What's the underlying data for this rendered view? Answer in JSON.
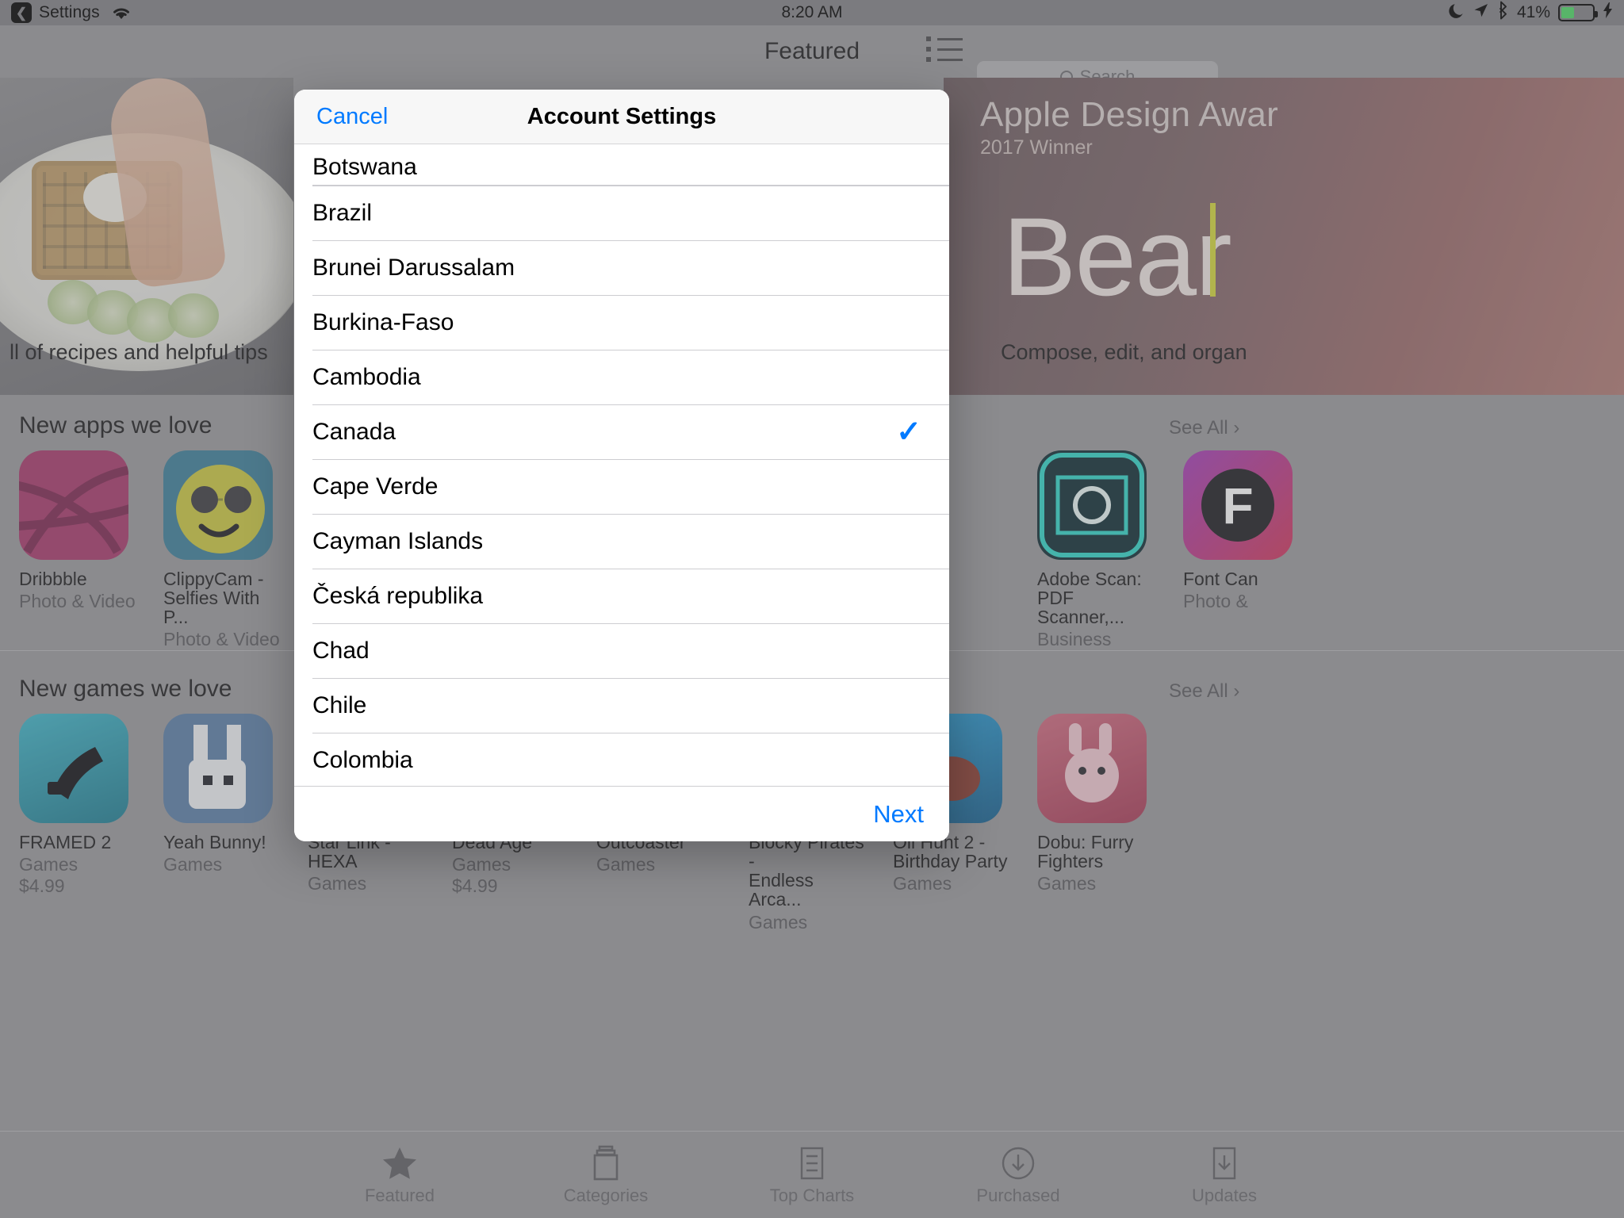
{
  "status_bar": {
    "back_label": "Settings",
    "back_icon": "chevron-left-icon",
    "wifi_icon": "wifi-icon",
    "time": "8:20 AM",
    "dnd_icon": "moon-icon",
    "location_icon": "location-arrow-icon",
    "bluetooth_icon": "bluetooth-icon",
    "battery_percent": "41%",
    "battery_level": 41,
    "charging_icon": "lightning-bolt-icon"
  },
  "nav_bar": {
    "title": "Featured",
    "list_icon": "list-icon",
    "search": {
      "placeholder": "Search",
      "value": "",
      "icon": "search-icon"
    }
  },
  "background": {
    "hero_left": {
      "caption": "ll of recipes and helpful tips"
    },
    "hero_right": {
      "title": "Apple Design Awar",
      "subtitle": "2017 Winner",
      "word": "Bear",
      "caption": "Compose, edit, and organ"
    },
    "sections": [
      {
        "title": "New apps we love",
        "see_all": "See All ›"
      },
      {
        "title": "New games we love",
        "see_all": "See All ›"
      }
    ],
    "apps_row1": [
      {
        "name": "Dribbble",
        "category": "Photo & Video",
        "color": "#a8386b"
      },
      {
        "name": "ClippyCam -\nSelfies With P...",
        "category": "Photo & Video",
        "color": "#3b7f99"
      },
      {
        "name": "Adobe Scan:\nPDF Scanner,...",
        "category": "Business",
        "color": "#0d2b33"
      },
      {
        "name": "Font Can",
        "category": "Photo &",
        "color": "#a23bb8"
      }
    ],
    "apps_row2": [
      {
        "name": "FRAMED 2",
        "category": "Games",
        "price": "$4.99",
        "color": "#2e9fb5"
      },
      {
        "name": "Yeah Bunny!",
        "category": "Games",
        "price": "",
        "color": "#5a7fa8"
      },
      {
        "name": "Star Link -\nHEXA",
        "category": "Games",
        "price": "",
        "color": "#2b2b3a"
      },
      {
        "name": "Dead Age",
        "category": "Games",
        "price": "$4.99",
        "color": "#5a4a3a"
      },
      {
        "name": "Outcoaster",
        "category": "Games",
        "price": "",
        "color": "#6a8a4a"
      },
      {
        "name": "Blocky Pirates -\nEndless Arca...",
        "category": "Games",
        "price": "",
        "color": "#2f6fa8"
      },
      {
        "name": "Oil Hunt 2 -\nBirthday Party",
        "category": "Games",
        "price": "",
        "color": "#1a5f8a"
      },
      {
        "name": "Dobu: Furry\nFighters",
        "category": "Games",
        "price": "",
        "color": "#c0536b"
      }
    ],
    "tabs": [
      {
        "label": "Featured",
        "icon": "star-icon",
        "active": true
      },
      {
        "label": "Categories",
        "icon": "box-icon",
        "active": false
      },
      {
        "label": "Top Charts",
        "icon": "ranked-list-icon",
        "active": false
      },
      {
        "label": "Purchased",
        "icon": "download-circle-icon",
        "active": false
      },
      {
        "label": "Updates",
        "icon": "download-arrow-icon",
        "active": false
      }
    ]
  },
  "modal": {
    "cancel_label": "Cancel",
    "title": "Account Settings",
    "next_label": "Next",
    "accent_color": "#007aff",
    "selected_country": "Canada",
    "check_icon": "checkmark-icon",
    "countries": [
      {
        "name": "Botswana",
        "selected": false,
        "clipped": true
      },
      {
        "name": "Brazil",
        "selected": false
      },
      {
        "name": "Brunei Darussalam",
        "selected": false
      },
      {
        "name": "Burkina-Faso",
        "selected": false
      },
      {
        "name": "Cambodia",
        "selected": false
      },
      {
        "name": "Canada",
        "selected": true
      },
      {
        "name": "Cape Verde",
        "selected": false
      },
      {
        "name": "Cayman Islands",
        "selected": false
      },
      {
        "name": "Česká republika",
        "selected": false
      },
      {
        "name": "Chad",
        "selected": false
      },
      {
        "name": "Chile",
        "selected": false
      },
      {
        "name": "Colombia",
        "selected": false
      }
    ]
  }
}
